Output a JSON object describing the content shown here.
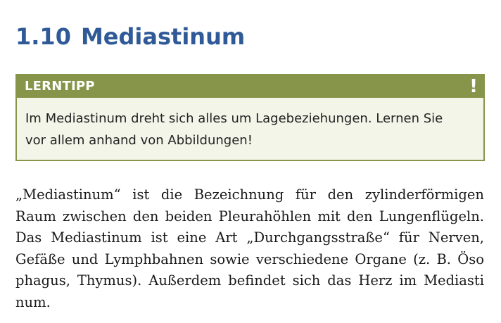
{
  "section": {
    "number": "1.10",
    "title": "Mediastinum"
  },
  "tip": {
    "title": "LERNTIPP",
    "icon": "!",
    "icon_name": "exclamation-icon",
    "lines": [
      "Im Mediastinum dreht sich alles um Lagebeziehungen. Lernen Sie",
      "vor allem anhand von Abbildungen!"
    ]
  },
  "body": {
    "lines": [
      "„Mediastinum“ ist die Bezeichnung für den zylinderförmigen",
      "Raum zwischen den beiden Pleurahöhlen mit den Lungenflügeln.",
      "Das Mediastinum ist eine Art „Durchgangsstraße“ für Nerven,",
      "Gefäße und Lymphbahnen sowie verschiedene Organe (z. B. Öso",
      "phagus, Thymus). Außerdem befindet sich das Herz im Mediasti",
      "num."
    ]
  },
  "colors": {
    "heading": "#2f5a97",
    "tip_border": "#86954a",
    "tip_background": "#f4f5e9"
  }
}
